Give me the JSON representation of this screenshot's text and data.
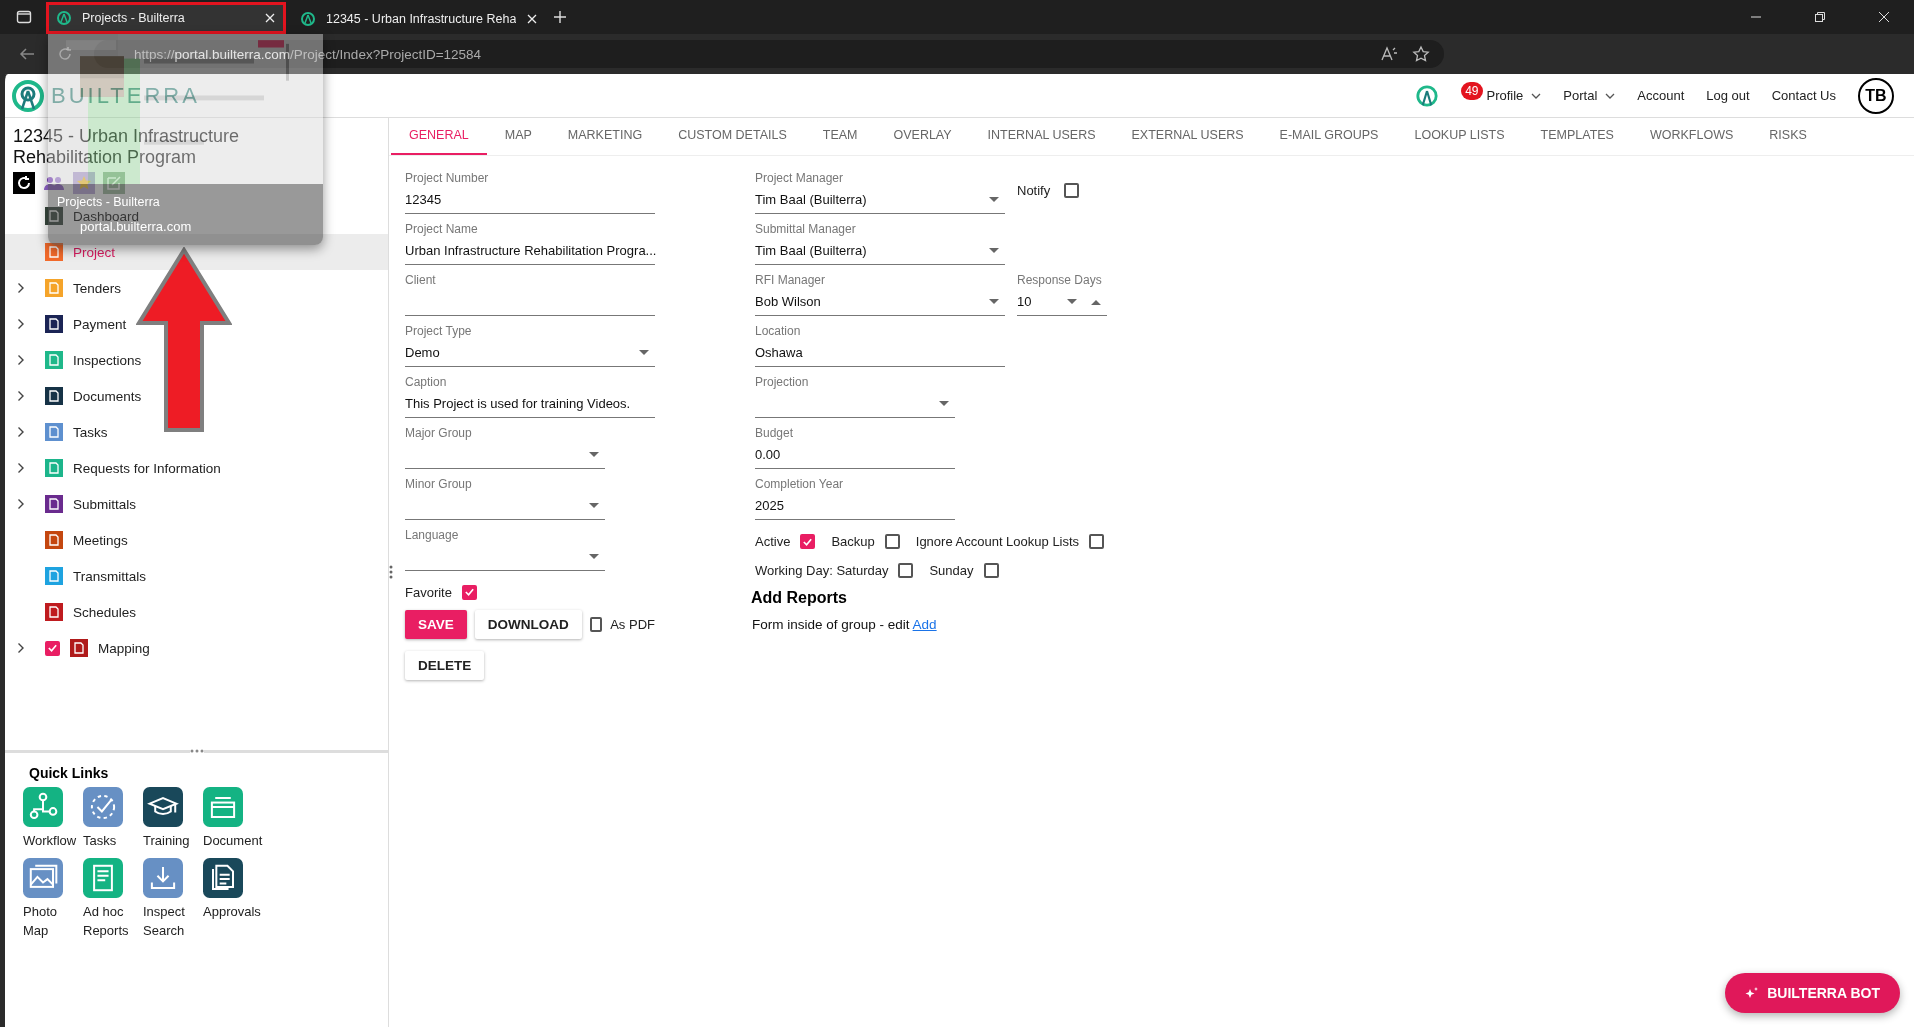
{
  "browser": {
    "tabs": [
      {
        "title": "Projects - Builterra",
        "selected": true
      },
      {
        "title": "12345 - Urban Infrastructure Reha",
        "selected": false
      }
    ],
    "url_scheme": "https://",
    "url_host": "portal.builterra.com",
    "url_path": "/Project/Index?ProjectID=12584"
  },
  "tab_preview": {
    "title": "Projects - Builterra",
    "host": "portal.builterra.com"
  },
  "header": {
    "logo": "BUILTERRA",
    "notification_count": "49",
    "nav": [
      {
        "label": "Profile",
        "dropdown": true
      },
      {
        "label": "Portal",
        "dropdown": true
      },
      {
        "label": "Account",
        "dropdown": false
      },
      {
        "label": "Log out",
        "dropdown": false
      },
      {
        "label": "Contact Us",
        "dropdown": false
      }
    ],
    "avatar": "TB"
  },
  "project_title": "12345 - Urban Infrastructure Rehabilitation Program",
  "sidebar": {
    "items": [
      {
        "label": "Dashboard",
        "expandable": false,
        "selected": false
      },
      {
        "label": "Project",
        "expandable": false,
        "selected": true,
        "color": "#f26a2b"
      },
      {
        "label": "Tenders",
        "expandable": true,
        "selected": false,
        "color": "#f5a42a"
      },
      {
        "label": "Payment",
        "expandable": true,
        "selected": false,
        "color": "#1b2455"
      },
      {
        "label": "Inspections",
        "expandable": true,
        "selected": false,
        "color": "#1fb88a"
      },
      {
        "label": "Documents",
        "expandable": true,
        "selected": false,
        "color": "#163246"
      },
      {
        "label": "Tasks",
        "expandable": true,
        "selected": false,
        "color": "#5e90cf"
      },
      {
        "label": "Requests for Information",
        "expandable": true,
        "selected": false,
        "color": "#1cb58b"
      },
      {
        "label": "Submittals",
        "expandable": true,
        "selected": false,
        "color": "#6a2b8e"
      },
      {
        "label": "Meetings",
        "expandable": false,
        "selected": false,
        "color": "#c4470f"
      },
      {
        "label": "Transmittals",
        "expandable": false,
        "selected": false,
        "color": "#1ea3e0"
      },
      {
        "label": "Schedules",
        "expandable": false,
        "selected": false,
        "color": "#bf1b1f"
      },
      {
        "label": "Mapping",
        "expandable": true,
        "selected": false,
        "color": "#b01a1a",
        "checked": true
      }
    ]
  },
  "quick_links": {
    "title": "Quick Links",
    "items": [
      {
        "label": "Workflow",
        "color": "#14b383"
      },
      {
        "label": "Tasks",
        "color": "#6790c4"
      },
      {
        "label": "Training",
        "color": "#19485a"
      },
      {
        "label": "Document",
        "color": "#14b383"
      },
      {
        "label": "Photo Map",
        "color": "#6790c4"
      },
      {
        "label": "Ad hoc Reports",
        "color": "#14b383"
      },
      {
        "label": "Inspect Search",
        "color": "#6790c4"
      },
      {
        "label": "Approvals",
        "color": "#19485a"
      }
    ]
  },
  "tabs": [
    {
      "label": "GENERAL",
      "selected": true
    },
    {
      "label": "MAP",
      "selected": false
    },
    {
      "label": "MARKETING",
      "selected": false
    },
    {
      "label": "CUSTOM DETAILS",
      "selected": false
    },
    {
      "label": "TEAM",
      "selected": false
    },
    {
      "label": "OVERLAY",
      "selected": false
    },
    {
      "label": "INTERNAL USERS",
      "selected": false
    },
    {
      "label": "EXTERNAL USERS",
      "selected": false
    },
    {
      "label": "E-MAIL GROUPS",
      "selected": false
    },
    {
      "label": "LOOKUP LISTS",
      "selected": false
    },
    {
      "label": "TEMPLATES",
      "selected": false
    },
    {
      "label": "WORKFLOWS",
      "selected": false
    },
    {
      "label": "RISKS",
      "selected": false
    }
  ],
  "form": {
    "left_fields": [
      {
        "label": "Project Number",
        "value": "12345",
        "kind": "text"
      },
      {
        "label": "Project Name",
        "value": "Urban Infrastructure Rehabilitation Progra...",
        "kind": "text"
      },
      {
        "label": "Client",
        "kind": "text"
      },
      {
        "label": "Project Type",
        "value": "Demo",
        "kind": "select"
      },
      {
        "label": "Caption",
        "value": "This Project is used for training Videos.",
        "kind": "text"
      },
      {
        "label": "Major Group",
        "kind": "select"
      },
      {
        "label": "Minor Group",
        "kind": "select"
      },
      {
        "label": "Language",
        "kind": "select"
      }
    ],
    "favorite": {
      "label": "Favorite",
      "checked": true
    },
    "buttons": [
      {
        "label": "SAVE",
        "kind": "primary"
      },
      {
        "label": "DOWNLOAD",
        "kind": "plain"
      }
    ],
    "as_pdf": {
      "label": "As PDF",
      "checked": false
    },
    "delete_button": "DELETE",
    "right_fields": [
      {
        "label": "Project Manager",
        "value": "Tim Baal (Builterra)",
        "kind": "select",
        "aside": {
          "kind": "checkbox",
          "label": "Notify",
          "checked": false
        }
      },
      {
        "label": "Submittal Manager",
        "value": "Tim Baal (Builterra)",
        "kind": "select"
      },
      {
        "label": "RFI Manager",
        "value": "Bob Wilson",
        "kind": "select",
        "aside": {
          "kind": "spinner",
          "label": "Response Days",
          "value": "10"
        }
      },
      {
        "label": "Location",
        "value": "Oshawa",
        "kind": "text"
      },
      {
        "label": "Projection",
        "kind": "select"
      },
      {
        "label": "Budget",
        "value": "0.00",
        "kind": "text"
      },
      {
        "label": "Completion Year",
        "value": "2025",
        "kind": "text"
      }
    ],
    "flags": [
      [
        {
          "label": "Active",
          "checked": true
        },
        {
          "label": "Backup",
          "checked": false
        },
        {
          "label": "Ignore Account Lookup Lists",
          "checked": false
        }
      ],
      [
        {
          "label": "Working Day: Saturday",
          "checked": false
        },
        {
          "label": "Sunday",
          "checked": false
        }
      ]
    ],
    "add_reports": {
      "title": "Add Reports",
      "text": "Form inside of group - edit",
      "link": "Add"
    }
  },
  "bot_button": "BUILTERRA BOT"
}
